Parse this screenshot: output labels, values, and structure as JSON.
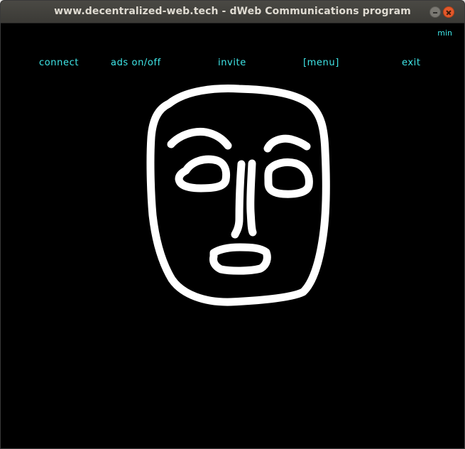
{
  "window": {
    "title": "www.decentralized-web.tech - dWeb Communications program"
  },
  "controls": {
    "min_label": "min"
  },
  "menu": {
    "items": [
      {
        "label": "connect"
      },
      {
        "label": "ads on/off"
      },
      {
        "label": "invite"
      },
      {
        "label": "[menu]"
      },
      {
        "label": "exit"
      }
    ]
  },
  "colors": {
    "accent": "#3fe6e8",
    "canvas_background": "#000000",
    "drawing_stroke": "#ffffff",
    "titlebar": "#3f3e3a",
    "close_button": "#e3582b"
  }
}
